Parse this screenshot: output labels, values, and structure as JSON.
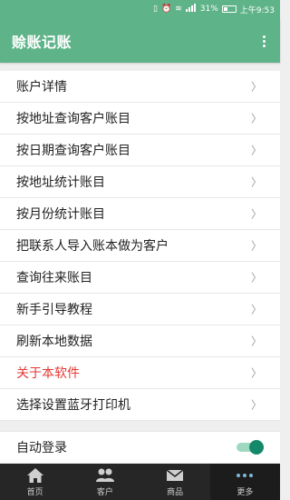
{
  "status_bar": {
    "battery": "31%",
    "time": "上午9:53",
    "signal_text": "4G"
  },
  "app_bar": {
    "title": "赊账记账"
  },
  "menu": {
    "items": [
      {
        "label": "账户详情"
      },
      {
        "label": "按地址查询客户账目"
      },
      {
        "label": "按日期查询客户账目"
      },
      {
        "label": "按地址统计账目"
      },
      {
        "label": "按月份统计账目"
      },
      {
        "label": "把联系人导入账本做为客户"
      },
      {
        "label": "查询往来账目"
      },
      {
        "label": "新手引导教程"
      },
      {
        "label": "刷新本地数据"
      },
      {
        "label": "关于本软件",
        "color": "#e53935"
      },
      {
        "label": "选择设置蓝牙打印机"
      }
    ],
    "chevron": "〉"
  },
  "settings": {
    "auto_login_label": "自动登录",
    "auto_login_enabled": true
  },
  "tab_bar": {
    "tabs": [
      {
        "label": "首页",
        "icon": "home-icon"
      },
      {
        "label": "客户",
        "icon": "people-icon"
      },
      {
        "label": "商品",
        "icon": "mail-icon"
      },
      {
        "label": "更多",
        "icon": "more-icon",
        "active": true
      }
    ]
  },
  "colors": {
    "primary": "#5fb389",
    "accent_red": "#e53935",
    "toggle_on": "#14896a",
    "tab_bar_bg": "#262626"
  }
}
